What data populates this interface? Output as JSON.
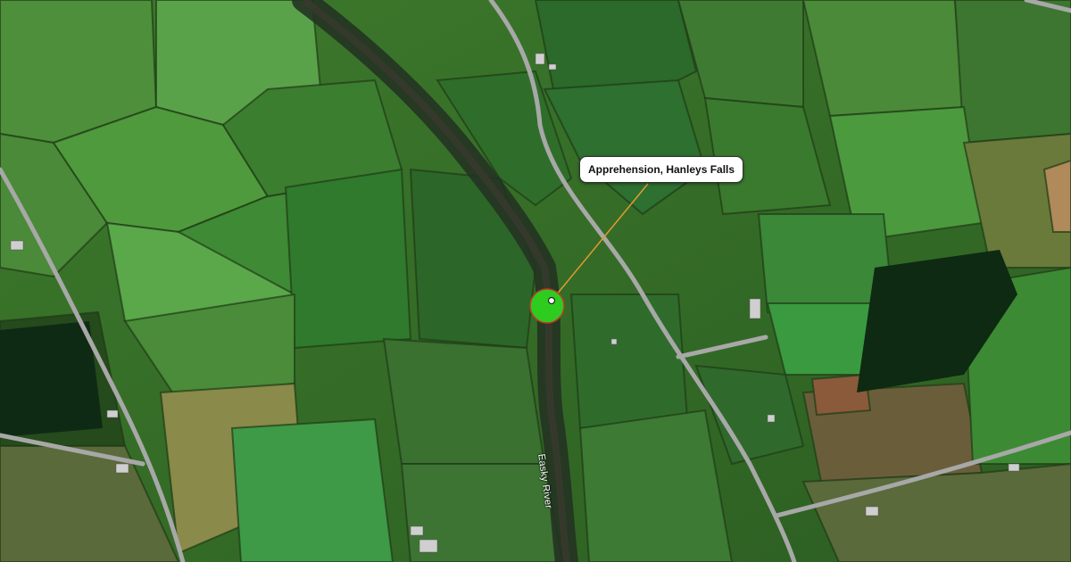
{
  "map": {
    "type": "satellite",
    "marker": {
      "label": "Apprehension, Hanleys Falls",
      "color": "#2ecc1f",
      "border_color": "#c0392b",
      "leader_color": "#e59a2f"
    },
    "labels": {
      "river": "Easky River"
    }
  }
}
